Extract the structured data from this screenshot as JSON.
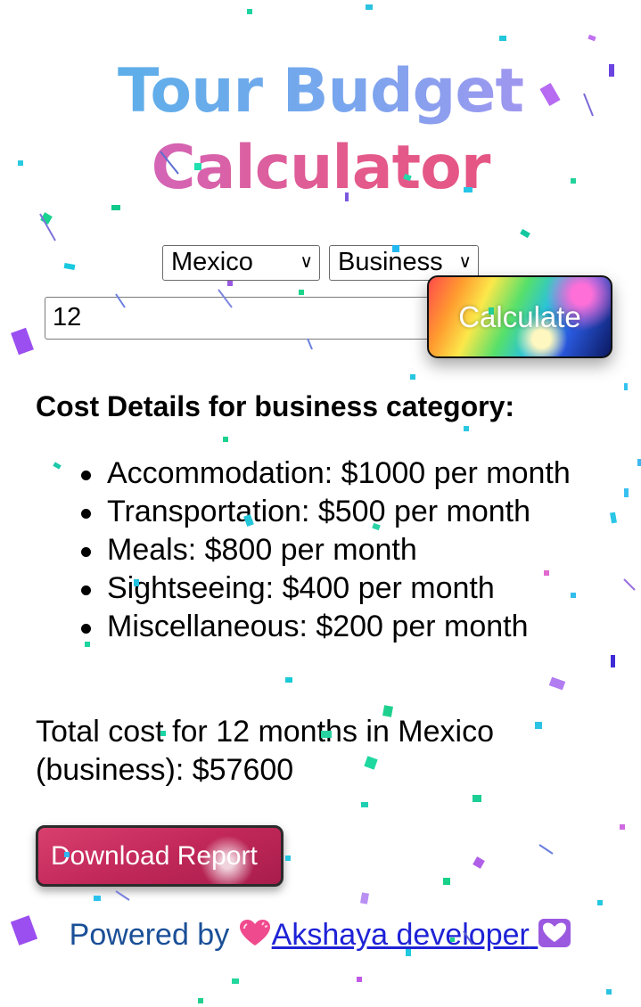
{
  "title": {
    "line1": "Tour Budget",
    "line2": "Calculator"
  },
  "form": {
    "country": "Mexico",
    "category": "Business",
    "months": "12",
    "calculate_label": "Calculate"
  },
  "cost_heading": "Cost Details for business category:",
  "costs": [
    "Accommodation: $1000 per month",
    "Transportation: $500 per month",
    "Meals: $800 per month",
    "Sightseeing: $400 per month",
    "Miscellaneous: $200 per month"
  ],
  "total": "Total cost for 12 months in Mexico (business): $57600",
  "download_label": "Download Report",
  "footer": {
    "prefix": "Powered by",
    "link_text": "Akshaya developer",
    "left_emoji": "pink-heart-icon",
    "right_emoji": "white-heart-icon"
  },
  "colors": {
    "title_top": "#6aa8ee",
    "title_bottom": "#e35a8c",
    "link": "#1e22d6",
    "footer_text": "#1a4f97",
    "download_button": "#c2285a"
  }
}
